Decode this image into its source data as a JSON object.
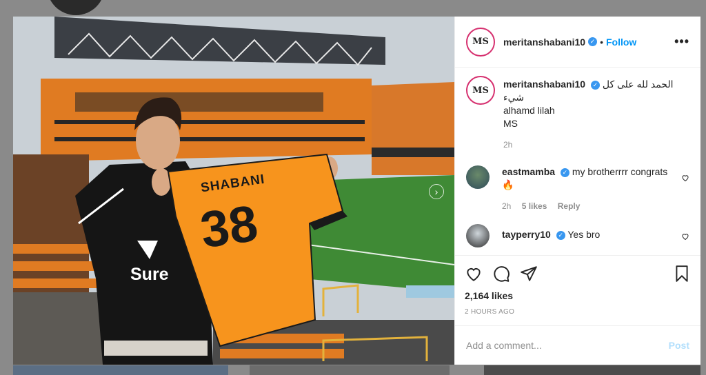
{
  "post": {
    "username": "meritanshabani10",
    "logo_text": "MS",
    "separator": "•",
    "follow_label": "Follow",
    "more_label": "•••",
    "jersey_name": "SHABANI",
    "jersey_number": "38",
    "sponsor": "Sure",
    "caption_line1": "الحمد لله على كل شيء",
    "caption_line2": "alhamd lilah",
    "caption_line3": "MS",
    "caption_time": "2h",
    "comments": [
      {
        "user": "eastmamba",
        "text": "my brotherrrr congrats 🔥",
        "time": "2h",
        "likes": "5 likes",
        "reply": "Reply"
      },
      {
        "user": "tayperry10",
        "text": "Yes bro"
      }
    ],
    "likes": "2,164 likes",
    "timestamp": "2 HOURS AGO",
    "add_comment_placeholder": "Add a comment...",
    "post_label": "Post"
  },
  "colors": {
    "accent": "#0095f6",
    "jersey": "#f7941d",
    "verified": "#3897f0"
  }
}
